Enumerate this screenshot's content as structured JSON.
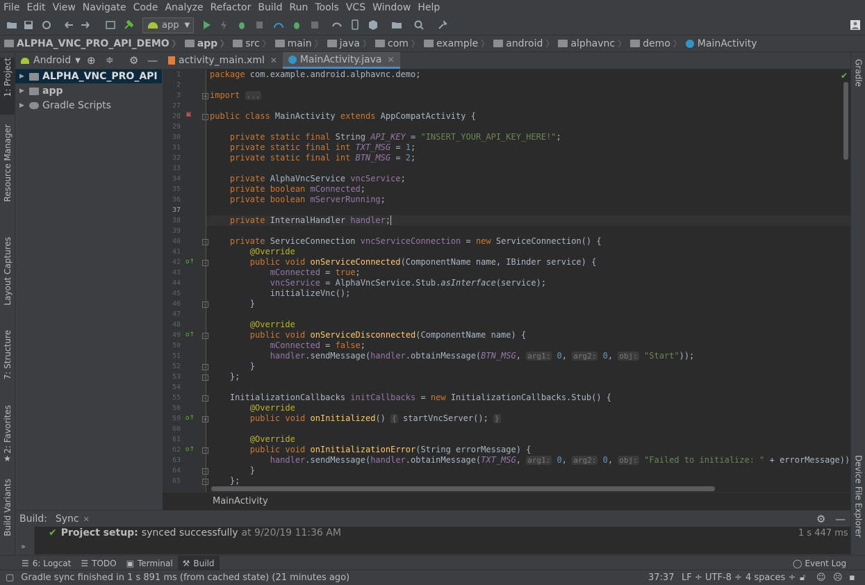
{
  "menu": [
    "File",
    "Edit",
    "View",
    "Navigate",
    "Code",
    "Analyze",
    "Refactor",
    "Build",
    "Run",
    "Tools",
    "VCS",
    "Window",
    "Help"
  ],
  "toolbar": {
    "run_config": "app"
  },
  "breadcrumbs": [
    "ALPHA_VNC_PRO_API_DEMO",
    "app",
    "src",
    "main",
    "java",
    "com",
    "example",
    "android",
    "alphavnc",
    "demo",
    "MainActivity"
  ],
  "project_panel": {
    "view_mode": "Android",
    "tree": [
      {
        "label": "ALPHA_VNC_PRO_API"
      },
      {
        "label": "app"
      },
      {
        "label": "Gradle Scripts"
      }
    ]
  },
  "left_tabs": {
    "project": "1: Project",
    "resource_manager": "Resource Manager",
    "layout_captures": "Layout Captures",
    "structure": "7: Structure",
    "favorites": "2: Favorites",
    "build_variants": "Build Variants"
  },
  "right_tabs": {
    "gradle": "Gradle",
    "device_file_explorer": "Device File Explorer"
  },
  "editor_tabs": [
    {
      "label": "activity_main.xml"
    },
    {
      "label": "MainActivity.java"
    }
  ],
  "line_numbers": [
    "1",
    "2",
    "3",
    "27",
    "28",
    "29",
    "30",
    "31",
    "32",
    "33",
    "34",
    "35",
    "36",
    "37",
    "38",
    "39",
    "40",
    "41",
    "42",
    "43",
    "44",
    "45",
    "46",
    "47",
    "48",
    "49",
    "50",
    "51",
    "52",
    "53",
    "54",
    "55",
    "56",
    "59",
    "60",
    "61",
    "62",
    "63",
    "64",
    "65"
  ],
  "editor_footer": "MainActivity",
  "build_panel": {
    "label": "Build:",
    "tab": "Sync",
    "status_bold": "Project setup:",
    "status_text": "synced successfully",
    "status_time": "at 9/20/19 11:36 AM",
    "duration": "1 s 447 ms"
  },
  "bottom_tools": [
    {
      "label": "6: Logcat"
    },
    {
      "label": "TODO"
    },
    {
      "label": "Terminal"
    },
    {
      "label": "Build"
    }
  ],
  "event_log": "Event Log",
  "status": {
    "message": "Gradle sync finished in 1 s 891 ms (from cached state) (21 minutes ago)",
    "position": "37:37",
    "line_sep": "LF",
    "encoding": "UTF-8",
    "indent": "4 spaces"
  }
}
